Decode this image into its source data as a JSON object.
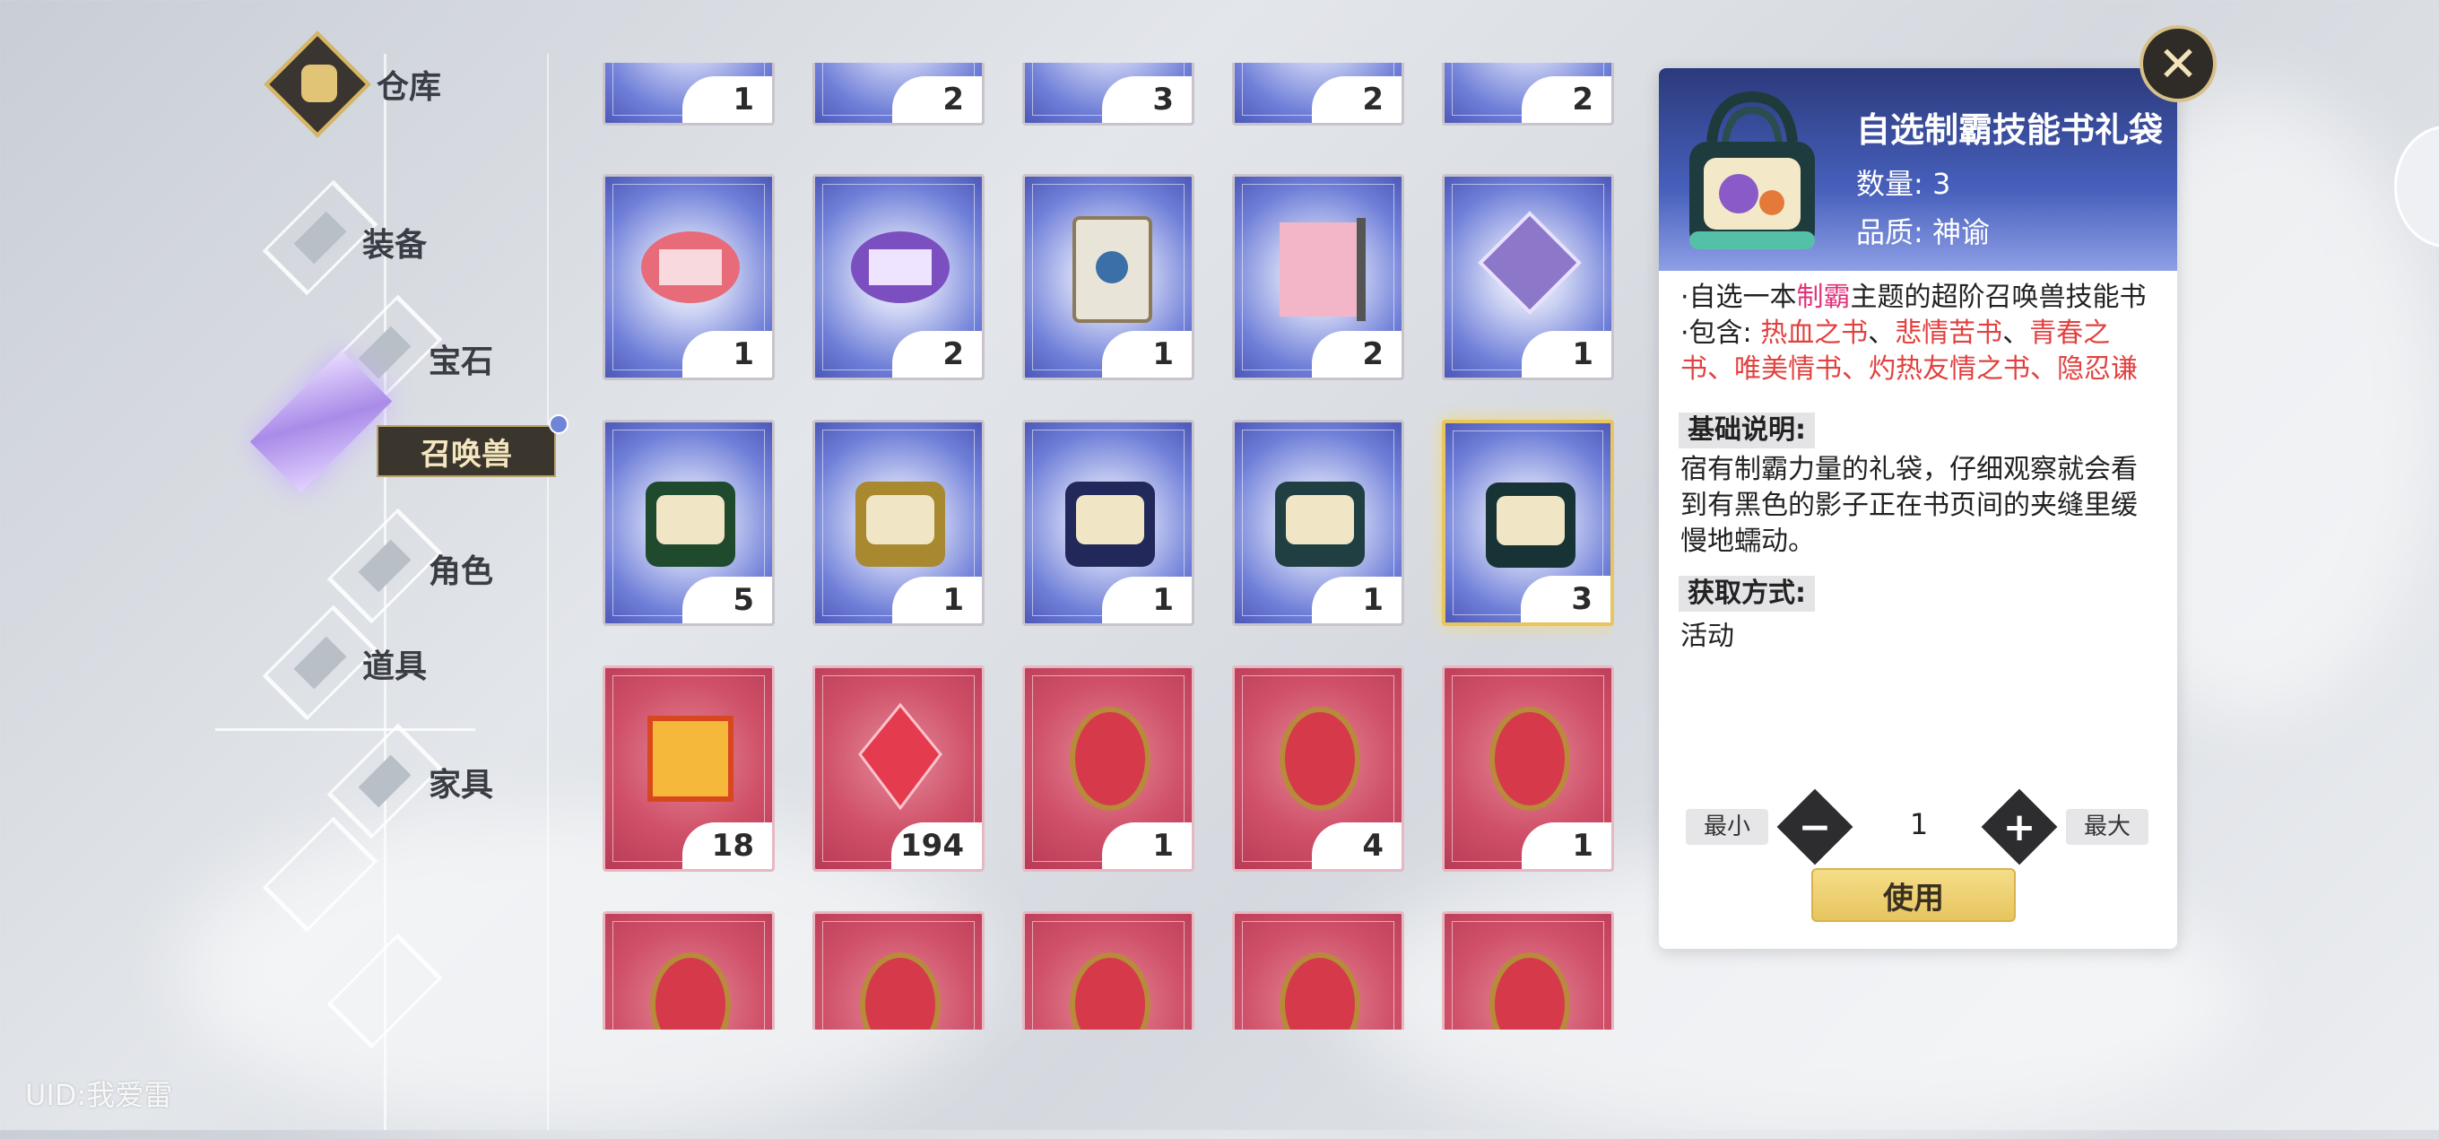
{
  "sidebar": {
    "warehouse_label": "仓库",
    "categories": [
      "装备",
      "宝石",
      "召唤兽",
      "角色",
      "道具",
      "家具"
    ],
    "active_category": "召唤兽",
    "uid": "UID:我爱雷"
  },
  "grid": {
    "rows": [
      [
        {
          "count": "1",
          "kind": "purple"
        },
        {
          "count": "2",
          "kind": "purple"
        },
        {
          "count": "3",
          "kind": "purple"
        },
        {
          "count": "2",
          "kind": "purple"
        },
        {
          "count": "2",
          "kind": "purple"
        }
      ],
      [
        {
          "count": "1",
          "kind": "purple",
          "art": "scroll-red-icon"
        },
        {
          "count": "2",
          "kind": "purple",
          "art": "scroll-purple-icon"
        },
        {
          "count": "1",
          "kind": "purple",
          "art": "book-icon"
        },
        {
          "count": "2",
          "kind": "purple",
          "art": "parchment-icon"
        },
        {
          "count": "1",
          "kind": "purple",
          "art": "cube-icon"
        }
      ],
      [
        {
          "count": "5",
          "kind": "purple",
          "art": "bag-green-icon"
        },
        {
          "count": "1",
          "kind": "purple",
          "art": "bag-gold-icon"
        },
        {
          "count": "1",
          "kind": "purple",
          "art": "bag-navy-icon"
        },
        {
          "count": "1",
          "kind": "purple",
          "art": "bag-teal-icon"
        },
        {
          "count": "3",
          "kind": "purple",
          "art": "bag-dark-icon",
          "selected": true
        }
      ],
      [
        {
          "count": "18",
          "kind": "red",
          "art": "gold-cube-icon"
        },
        {
          "count": "194",
          "kind": "red",
          "art": "red-crystal-icon"
        },
        {
          "count": "1",
          "kind": "red",
          "art": "red-gem-icon"
        },
        {
          "count": "4",
          "kind": "red",
          "art": "red-gem-icon"
        },
        {
          "count": "1",
          "kind": "red",
          "art": "red-gem-icon"
        }
      ],
      [
        {
          "count": "",
          "kind": "red",
          "art": "red-gem-icon"
        },
        {
          "count": "",
          "kind": "red",
          "art": "red-gem-icon"
        },
        {
          "count": "",
          "kind": "red",
          "art": "red-gem-icon"
        },
        {
          "count": "",
          "kind": "red",
          "art": "red-gem-icon"
        },
        {
          "count": "",
          "kind": "red",
          "art": "red-gem-icon"
        }
      ]
    ]
  },
  "detail": {
    "title": "自选制霸技能书礼袋",
    "quantity": "数量: 3",
    "quality": "品质: 神谕",
    "desc_prefix": "·自选一本",
    "desc_highlight": "制霸",
    "desc_suffix": "主题的超阶召唤兽技能书",
    "contains_label": "·包含: ",
    "contains_1": "热血之书",
    "sep": "、",
    "contains_2": "悲情苦书",
    "contains_3": "青春之书",
    "contains_more": "、唯美情书、灼热友情之书、隐忍谦",
    "basic_header": "基础说明:",
    "basic_text": "宿有制霸力量的礼袋，仔细观察就会看到有黑色的影子正在书页间的夹缝里缓慢地蠕动。",
    "source_header": "获取方式:",
    "source_text": "活动",
    "min_label": "最小",
    "max_label": "最大",
    "qty_value": "1",
    "use_label": "使用",
    "close_glyph": "✕"
  }
}
